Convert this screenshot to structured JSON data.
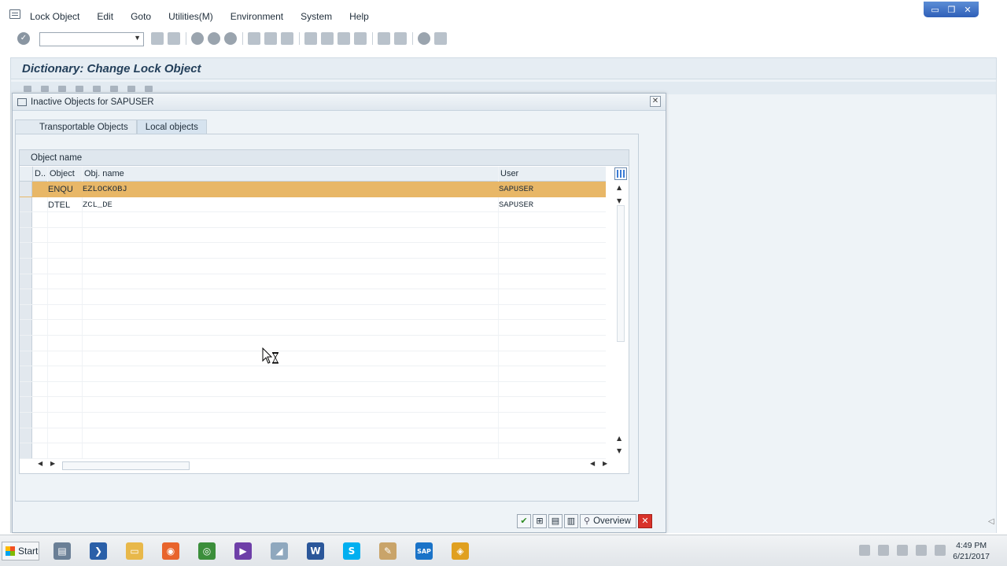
{
  "menu": {
    "items": [
      "Lock Object",
      "Edit",
      "Goto",
      "Utilities(M)",
      "Environment",
      "System",
      "Help"
    ]
  },
  "window_controls": [
    "▭",
    "❐",
    "✕"
  ],
  "toolbar": {
    "command_field_value": "",
    "icons": [
      "back-icon",
      "save-icon",
      "refresh-icon",
      "exit-icon",
      "cancel-icon",
      "print-icon",
      "find-icon",
      "find-next-icon",
      "first-page-icon",
      "prev-page-icon",
      "next-page-icon",
      "last-page-icon",
      "create-session-icon",
      "shortcut-icon",
      "help-icon",
      "customize-layout-icon"
    ]
  },
  "screen": {
    "title": "Dictionary: Change Lock Object"
  },
  "popup": {
    "title": "Inactive Objects for SAPUSER",
    "close_glyph": "✕",
    "tabs": [
      {
        "label": "Transportable Objects",
        "active": false
      },
      {
        "label": "Local objects",
        "active": true
      }
    ],
    "grid": {
      "caption": "Object name",
      "columns": {
        "d": "D..",
        "object": "Object",
        "obj_name": "Obj. name",
        "user": "User"
      },
      "rows": [
        {
          "d": "",
          "object": "ENQU",
          "obj_name": "EZLOCKOBJ",
          "user": "SAPUSER",
          "selected": true
        },
        {
          "d": "",
          "object": "DTEL",
          "obj_name": "ZCL_DE",
          "user": "SAPUSER",
          "selected": false
        }
      ]
    },
    "buttons": {
      "continue": "✔",
      "overview_label": "Overview",
      "cancel": "✕"
    }
  },
  "taskbar": {
    "start_label": "Start",
    "apps": [
      {
        "name": "server-manager-icon",
        "glyph": "▤",
        "color": "#6a7f96"
      },
      {
        "name": "powershell-icon",
        "glyph": "❯",
        "color": "#2a5fa8"
      },
      {
        "name": "explorer-icon",
        "glyph": "▭",
        "color": "#e8b84a"
      },
      {
        "name": "firefox-icon",
        "glyph": "◉",
        "color": "#e8642c"
      },
      {
        "name": "chrome-icon",
        "glyph": "◎",
        "color": "#3b8e3b"
      },
      {
        "name": "visual-studio-icon",
        "glyph": "▶",
        "color": "#6e3fa8"
      },
      {
        "name": "sap-logon-pad-icon",
        "glyph": "◢",
        "color": "#8fa8be"
      },
      {
        "name": "word-icon",
        "glyph": "W",
        "color": "#2b579a"
      },
      {
        "name": "skype-icon",
        "glyph": "S",
        "color": "#00aff0"
      },
      {
        "name": "paint-icon",
        "glyph": "✎",
        "color": "#c9a46a"
      },
      {
        "name": "sap-icon",
        "glyph": "SAP",
        "color": "#1a73c8"
      },
      {
        "name": "sap-gui-icon",
        "glyph": "◈",
        "color": "#e0a020"
      }
    ],
    "time": "4:49 PM",
    "date": "6/21/2017"
  }
}
